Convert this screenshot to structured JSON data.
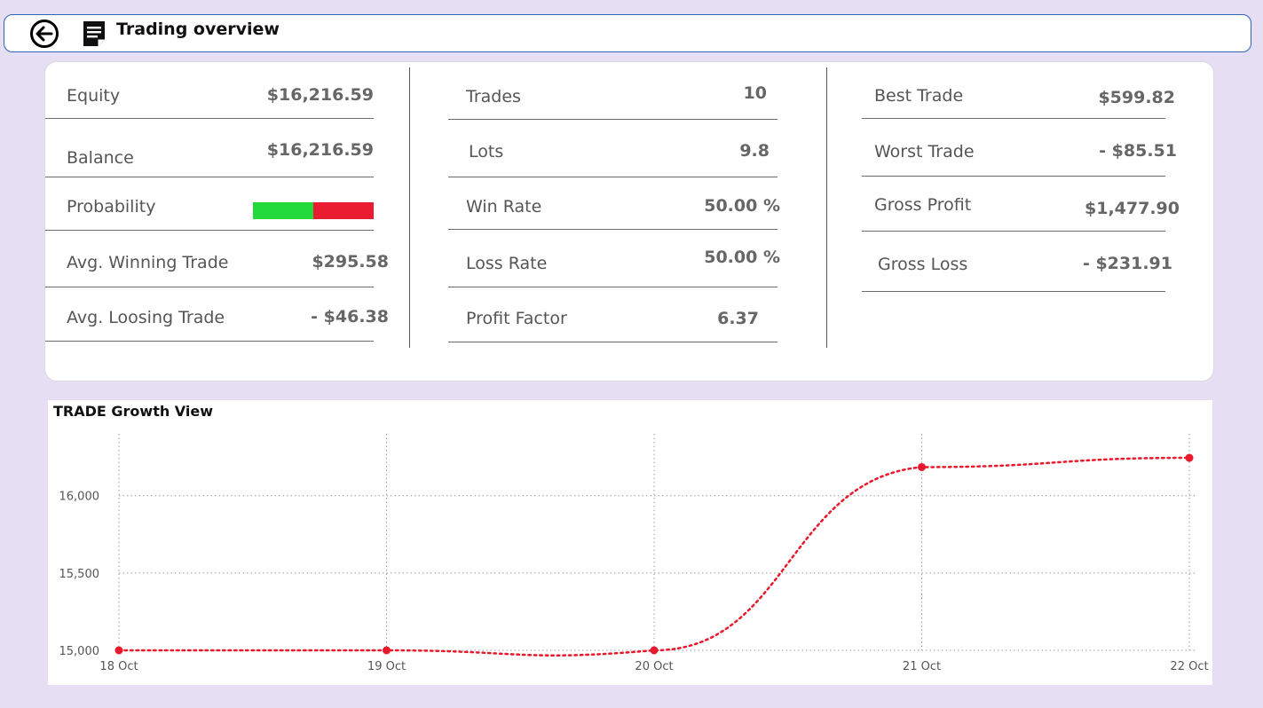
{
  "header": {
    "title": "Trading overview",
    "back_icon": "back-arrow-circle-icon",
    "doc_icon": "document-icon"
  },
  "stats": {
    "col1": [
      {
        "label": "Equity",
        "value": "$16,216.59"
      },
      {
        "label": "Balance",
        "value": "$16,216.59"
      },
      {
        "label": "Probability",
        "value": ""
      },
      {
        "label": "Avg. Winning Trade",
        "value": "$295.58"
      },
      {
        "label": "Avg. Loosing Trade",
        "value": "- $46.38"
      }
    ],
    "col2": [
      {
        "label": "Trades",
        "value": "10"
      },
      {
        "label": "Lots",
        "value": "9.8"
      },
      {
        "label": "Win Rate",
        "value": "50.00 %"
      },
      {
        "label": "Loss Rate",
        "value": "50.00 %"
      },
      {
        "label": "Profit Factor",
        "value": "6.37"
      }
    ],
    "col3": [
      {
        "label": "Best Trade",
        "value": "$599.82"
      },
      {
        "label": "Worst Trade",
        "value": "- $85.51"
      },
      {
        "label": "Gross Profit",
        "value": "$1,477.90"
      },
      {
        "label": "Gross Loss",
        "value": "- $231.91"
      }
    ],
    "probability": {
      "win_fraction": 0.5,
      "win_color": "#21d93b",
      "loss_color": "#ea1c32"
    }
  },
  "chart_data": {
    "type": "line",
    "title": "TRADE Growth View",
    "x": [
      "18 Oct",
      "19 Oct",
      "20 Oct",
      "21 Oct",
      "22 Oct"
    ],
    "series": [
      {
        "values": [
          15000,
          15000,
          15000,
          16185,
          16245
        ]
      }
    ],
    "yticks": [
      15000,
      15500,
      16000
    ],
    "ytick_labels": [
      "15,000",
      "15,500",
      "16,000"
    ],
    "ylim": [
      15000,
      16400
    ],
    "line_color": "#e8192c",
    "line_style": "dotted",
    "grid": true
  }
}
